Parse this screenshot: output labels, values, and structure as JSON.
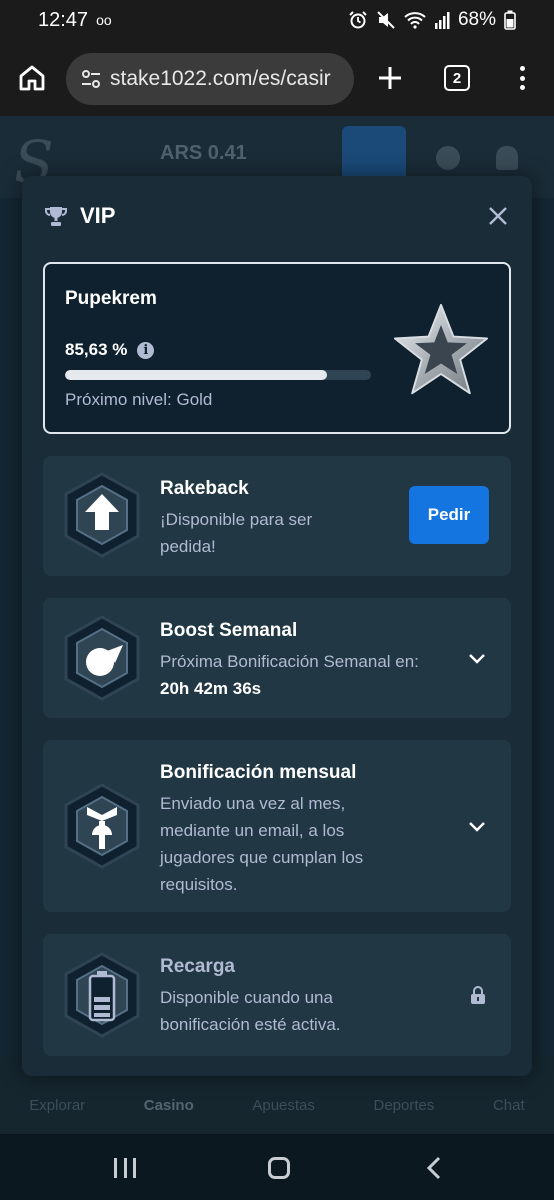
{
  "status_bar": {
    "time": "12:47",
    "voicemail": "oo",
    "battery": "68%"
  },
  "browser": {
    "url": "stake1022.com/es/casir",
    "tab_count": "2"
  },
  "background_site": {
    "balance": "ARS 0.41",
    "bottom_nav": [
      "Explorar",
      "Casino",
      "Apuestas",
      "Deportes",
      "Chat"
    ]
  },
  "modal": {
    "title": "VIP",
    "progress": {
      "username": "Pupekrem",
      "percent_label": "85,63 %",
      "percent_value": 85.63,
      "next_level": "Próximo nivel: Gold"
    },
    "cards": [
      {
        "title": "Rakeback",
        "description": "¡Disponible para ser pedida!",
        "button": "Pedir"
      },
      {
        "title": "Boost Semanal",
        "description": "Próxima Bonificación Semanal en:",
        "countdown": "20h 42m 36s"
      },
      {
        "title": "Bonificación mensual",
        "description": "Enviado una vez al mes, mediante un email, a los jugadores que cumplan los requisitos."
      },
      {
        "title": "Recarga",
        "description": "Disponible cuando una bonificación esté activa."
      }
    ]
  },
  "icons": {
    "trophy": "trophy-icon",
    "close": "close-icon",
    "info": "info-icon",
    "star": "silver-star-icon",
    "chevron": "chevron-down-icon",
    "lock": "lock-icon"
  },
  "colors": {
    "modal_bg": "#1a2c38",
    "card_bg": "#213743",
    "accent_button": "#1475e1",
    "muted_text": "#b1bad3"
  }
}
